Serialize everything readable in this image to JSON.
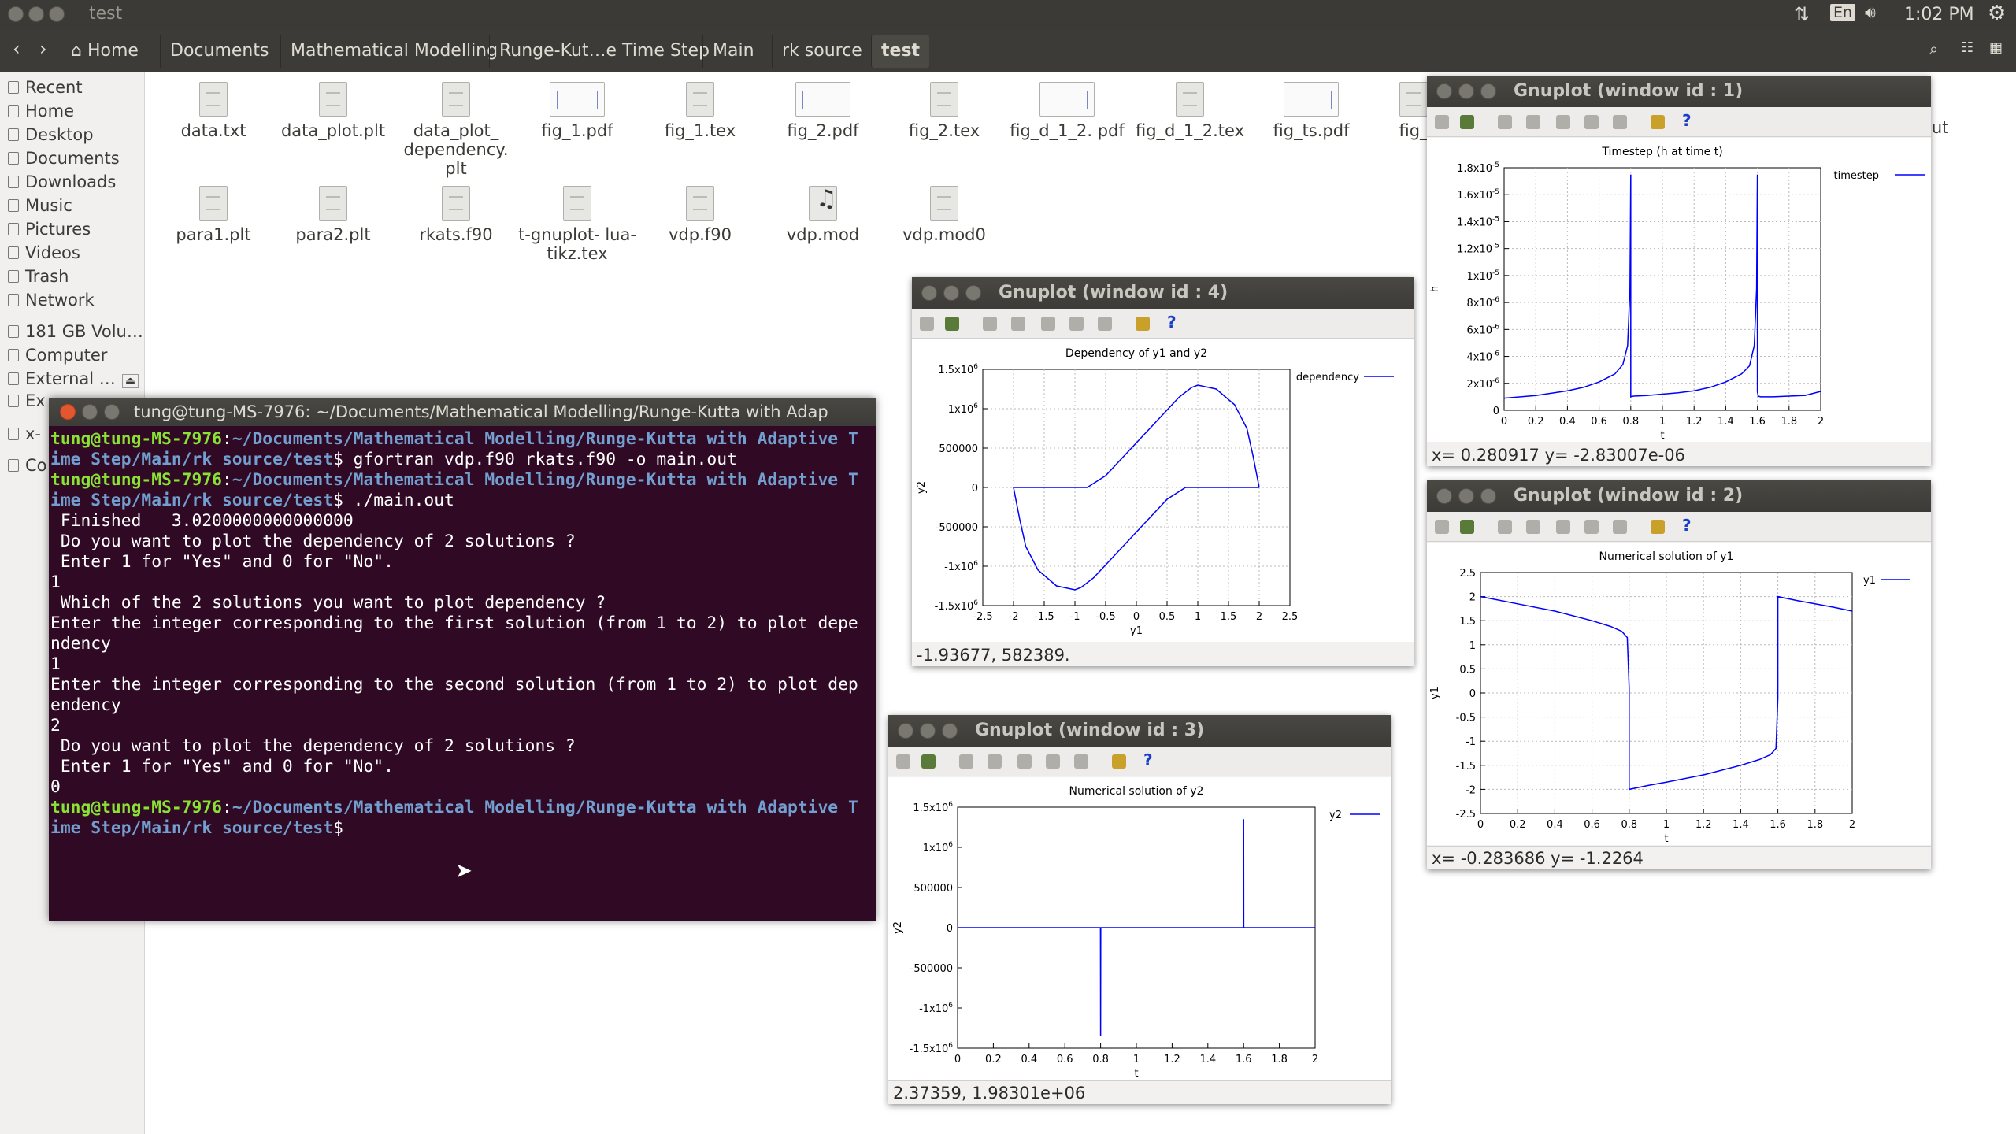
{
  "topbar": {
    "window_title": "test",
    "lang": "En",
    "clock": "1:02 PM"
  },
  "nav": {
    "breadcrumbs": [
      "Home",
      "Documents",
      "Mathematical Modelling",
      "Runge-Kut…e Time Step",
      "Main",
      "rk source",
      "test"
    ]
  },
  "sidebar": {
    "items": [
      "Recent",
      "Home",
      "Desktop",
      "Documents",
      "Downloads",
      "Music",
      "Pictures",
      "Videos",
      "Trash",
      "Network",
      "181 GB Volu…",
      "Computer",
      "External …",
      "Ex",
      "x-",
      "Co"
    ]
  },
  "files": [
    {
      "name": "data.txt",
      "kind": "text"
    },
    {
      "name": "data_plot.plt",
      "kind": "text"
    },
    {
      "name": "data_plot_ dependency. plt",
      "kind": "text"
    },
    {
      "name": "fig_1.pdf",
      "kind": "pdf"
    },
    {
      "name": "fig_1.tex",
      "kind": "text"
    },
    {
      "name": "fig_2.pdf",
      "kind": "pdf"
    },
    {
      "name": "fig_2.tex",
      "kind": "text"
    },
    {
      "name": "fig_d_1_2. pdf",
      "kind": "pdf"
    },
    {
      "name": "fig_d_1_2.tex",
      "kind": "text"
    },
    {
      "name": "fig_ts.pdf",
      "kind": "pdf"
    },
    {
      "name": "fig_",
      "kind": "text"
    },
    {
      "name": "para1.plt",
      "kind": "text"
    },
    {
      "name": "para2.plt",
      "kind": "text"
    },
    {
      "name": "rkats.f90",
      "kind": "text"
    },
    {
      "name": "t-gnuplot- lua-tikz.tex",
      "kind": "text"
    },
    {
      "name": "vdp.f90",
      "kind": "text"
    },
    {
      "name": "vdp.mod",
      "kind": "music"
    },
    {
      "name": "vdp.mod0",
      "kind": "text"
    }
  ],
  "hidden_file_tail": "out",
  "terminal": {
    "title": "tung@tung-MS-7976: ~/Documents/Mathematical Modelling/Runge-Kutta with Adap",
    "prompt_user": "tung@tung-MS-7976",
    "prompt_path_1": "~/Documents/Mathematical Modelling/Runge-Kutta with Adaptive T",
    "prompt_path_2": "ime Step/Main/rk source/test",
    "cmd1": "$ gfortran vdp.f90 rkats.f90 -o main.out",
    "cmd2": "$ ./main.out",
    "out1": " Finished   3.0200000000000000",
    "out2": " Do you want to plot the dependency of 2 solutions ?",
    "out3": " Enter 1 for \"Yes\" and 0 for \"No\".",
    "in1": "1",
    "out4": " Which of the 2 solutions you want to plot dependency ?",
    "out5a": "Enter the integer corresponding to the first solution (from 1 to 2) to plot depe",
    "out5b": "ndency",
    "in2": "1",
    "out6a": "Enter the integer corresponding to the second solution (from 1 to 2) to plot dep",
    "out6b": "endency",
    "in3": "2",
    "out7": " Do you want to plot the dependency of 2 solutions ?",
    "out8": " Enter 1 for \"Yes\" and 0 for \"No\".",
    "in4": "0",
    "prompt_end": "$"
  },
  "gnuplot_windows": [
    {
      "title": "Gnuplot (window id : 1)",
      "status": "x=   0.280917   y=  -2.83007e-06"
    },
    {
      "title": "Gnuplot (window id : 2)",
      "status": "x=  -0.283686   y=    -1.2264"
    },
    {
      "title": "Gnuplot (window id : 3)",
      "status": "2.37359,  1.98301e+06"
    },
    {
      "title": "Gnuplot (window id : 4)",
      "status": "-1.93677,  582389."
    }
  ],
  "chart_data": [
    {
      "type": "line",
      "window": "Gnuplot (window id : 1)",
      "title": "Timestep (h at time t)",
      "xlabel": "t",
      "ylabel": "h",
      "xlim": [
        0,
        2
      ],
      "ylim": [
        0,
        1.8e-05
      ],
      "xticks": [
        "0",
        "0.2",
        "0.4",
        "0.6",
        "0.8",
        "1",
        "1.2",
        "1.4",
        "1.6",
        "1.8",
        "2"
      ],
      "yticks": [
        "0",
        "2x10-6",
        "4x10-6",
        "6x10-6",
        "8x10-6",
        "1x10-5",
        "1.2x10-5",
        "1.4x10-5",
        "1.6x10-5",
        "1.8x10-5"
      ],
      "grid": true,
      "legend": "top-right",
      "color": "#0000ff",
      "series": [
        {
          "name": "timestep",
          "x": [
            0,
            0.2,
            0.4,
            0.5,
            0.6,
            0.7,
            0.75,
            0.78,
            0.795,
            0.8,
            0.8,
            0.805,
            0.82,
            0.9,
            1.0,
            1.1,
            1.2,
            1.3,
            1.4,
            1.5,
            1.55,
            1.58,
            1.595,
            1.6,
            1.6,
            1.605,
            1.62,
            1.7,
            1.8,
            1.9,
            2.0
          ],
          "y": [
            9e-07,
            1.1e-06,
            1.45e-06,
            1.7e-06,
            2.1e-06,
            2.7e-06,
            3.4e-06,
            4.8e-06,
            9e-06,
            1.75e-05,
            1e-06,
            1.02e-06,
            1.05e-06,
            1.1e-06,
            1.2e-06,
            1.3e-06,
            1.45e-06,
            1.7e-06,
            2.1e-06,
            2.7e-06,
            3.3e-06,
            4.8e-06,
            9e-06,
            1.75e-05,
            1.4e-06,
            1.05e-06,
            1e-06,
            1e-06,
            1.05e-06,
            1.1e-06,
            1.4e-06
          ]
        }
      ]
    },
    {
      "type": "line",
      "window": "Gnuplot (window id : 2)",
      "title": "Numerical solution of y1",
      "xlabel": "t",
      "ylabel": "y1",
      "xlim": [
        0,
        2
      ],
      "ylim": [
        -2.5,
        2.5
      ],
      "xticks": [
        "0",
        "0.2",
        "0.4",
        "0.6",
        "0.8",
        "1",
        "1.2",
        "1.4",
        "1.6",
        "1.8",
        "2"
      ],
      "yticks": [
        "-2.5",
        "-2",
        "-1.5",
        "-1",
        "-0.5",
        "0",
        "0.5",
        "1",
        "1.5",
        "2",
        "2.5"
      ],
      "grid": true,
      "legend": "top-right",
      "color": "#0000ff",
      "series": [
        {
          "name": "y1",
          "x": [
            0,
            0.2,
            0.4,
            0.6,
            0.7,
            0.76,
            0.79,
            0.8,
            0.8,
            0.9,
            1.0,
            1.2,
            1.4,
            1.5,
            1.56,
            1.59,
            1.6,
            1.6,
            1.7,
            1.8,
            1.9,
            2.0
          ],
          "y": [
            2.0,
            1.85,
            1.7,
            1.5,
            1.38,
            1.28,
            1.15,
            0.1,
            -2.0,
            -1.92,
            -1.85,
            -1.7,
            -1.5,
            -1.38,
            -1.28,
            -1.15,
            -0.1,
            2.0,
            1.92,
            1.85,
            1.78,
            1.7
          ]
        }
      ]
    },
    {
      "type": "line",
      "window": "Gnuplot (window id : 3)",
      "title": "Numerical solution of y2",
      "xlabel": "t",
      "ylabel": "y2",
      "xlim": [
        0,
        2
      ],
      "ylim": [
        -1500000.0,
        1500000.0
      ],
      "xticks": [
        "0",
        "0.2",
        "0.4",
        "0.6",
        "0.8",
        "1",
        "1.2",
        "1.4",
        "1.6",
        "1.8",
        "2"
      ],
      "yticks": [
        "-1.5x10^6",
        "-1x10^6",
        "-500000",
        "0",
        "500000",
        "1x10^6",
        "1.5x10^6"
      ],
      "grid": false,
      "legend": "top-right",
      "color": "#0000ff",
      "series": [
        {
          "name": "y2",
          "x": [
            0,
            0.799,
            0.8,
            0.801,
            1.599,
            1.6,
            1.601,
            2.0
          ],
          "y": [
            0,
            0,
            -1350000.0,
            0,
            0,
            1350000.0,
            0,
            0
          ]
        }
      ]
    },
    {
      "type": "line",
      "window": "Gnuplot (window id : 4)",
      "title": "Dependency of y1 and y2",
      "xlabel": "y1",
      "ylabel": "y2",
      "xlim": [
        -2.5,
        2.5
      ],
      "ylim": [
        -1500000.0,
        1500000.0
      ],
      "xticks": [
        "-2.5",
        "-2",
        "-1.5",
        "-1",
        "-0.5",
        "0",
        "0.5",
        "1",
        "1.5",
        "2",
        "2.5"
      ],
      "yticks": [
        "-1.5x10^6",
        "-1x10^6",
        "-500000",
        "0",
        "500000",
        "1x10^6",
        "1.5x10^6"
      ],
      "grid": true,
      "legend": "top-right",
      "color": "#0000ff",
      "series": [
        {
          "name": "dependency",
          "x": [
            2.0,
            1.6,
            1.4,
            1.2,
            1.0,
            0.8,
            0.5,
            0.2,
            -0.1,
            -0.4,
            -0.7,
            -0.9,
            -1.0,
            -1.3,
            -1.6,
            -1.8,
            -1.9,
            -2.0,
            -1.6,
            -1.4,
            -1.2,
            -1.0,
            -0.8,
            -0.5,
            -0.2,
            0.1,
            0.4,
            0.7,
            0.9,
            1.0,
            1.3,
            1.6,
            1.8,
            1.9,
            2.0
          ],
          "y": [
            0,
            0,
            0,
            0,
            0,
            0,
            -150000,
            -400000,
            -650000,
            -900000,
            -1150000,
            -1270000,
            -1300000,
            -1250000,
            -1050000,
            -750000,
            -400000,
            0,
            0,
            0,
            0,
            0,
            0,
            150000,
            400000,
            650000,
            900000,
            1150000,
            1270000,
            1300000,
            1250000,
            1050000,
            750000,
            400000,
            0
          ]
        }
      ]
    }
  ]
}
